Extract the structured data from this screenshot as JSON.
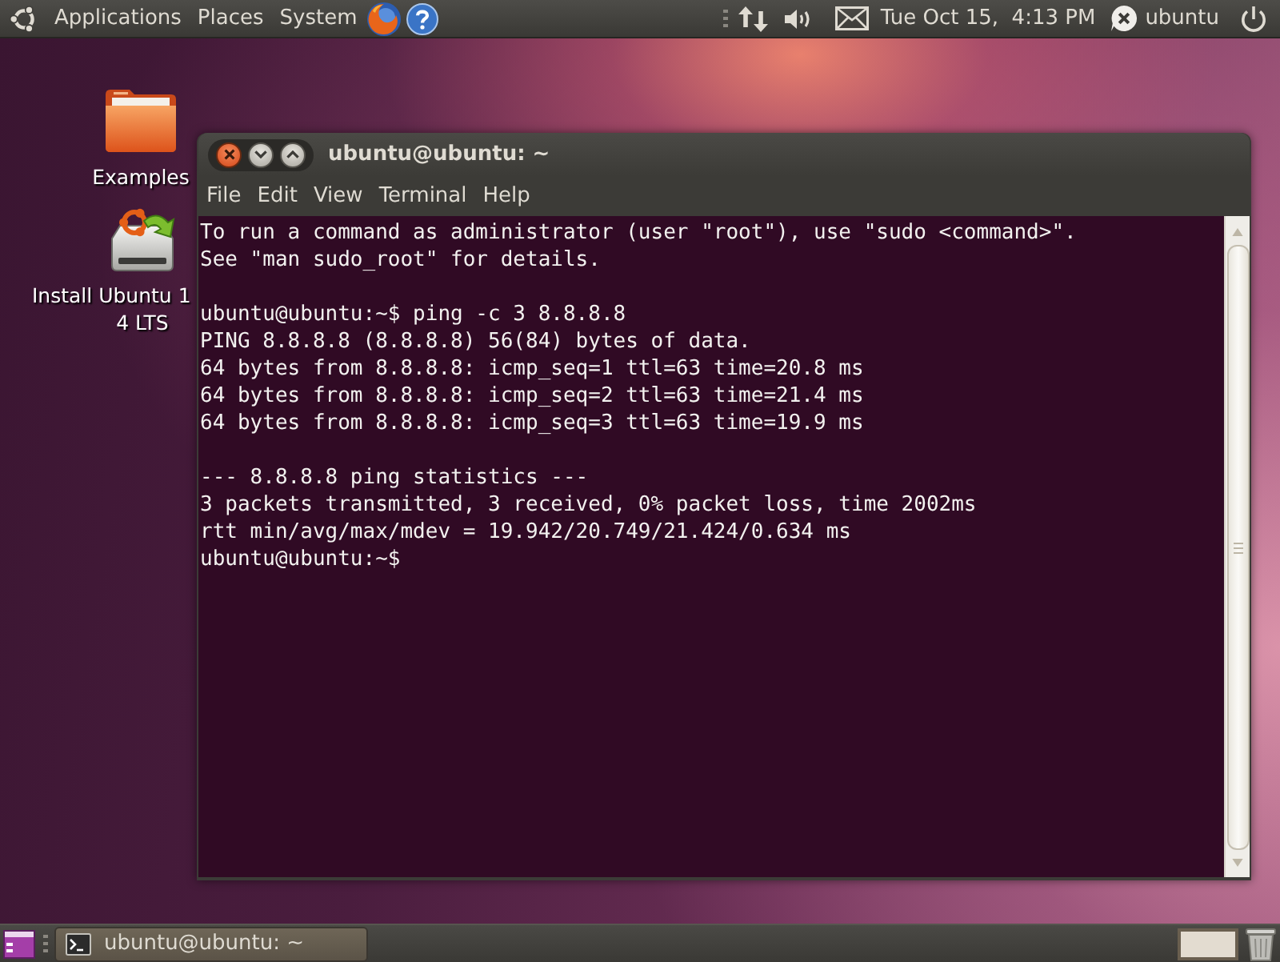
{
  "top_panel": {
    "menus": [
      "Applications",
      "Places",
      "System"
    ],
    "clock": "Tue Oct 15,  4:13 PM",
    "user": "ubuntu"
  },
  "desktop_icons": [
    {
      "kind": "folder",
      "label": [
        "Examples"
      ]
    },
    {
      "kind": "installer",
      "label": [
        "Install Ubuntu 1",
        "4 LTS"
      ]
    }
  ],
  "terminal": {
    "title": "ubuntu@ubuntu: ~",
    "menu": [
      "File",
      "Edit",
      "View",
      "Terminal",
      "Help"
    ],
    "blocks": [
      [
        "To run a command as administrator (user \"root\"), use \"sudo <command>\".",
        "See \"man sudo_root\" for details."
      ],
      [
        "ubuntu@ubuntu:~$ ping -c 3 8.8.8.8",
        "PING 8.8.8.8 (8.8.8.8) 56(84) bytes of data.",
        "64 bytes from 8.8.8.8: icmp_seq=1 ttl=63 time=20.8 ms",
        "64 bytes from 8.8.8.8: icmp_seq=2 ttl=63 time=21.4 ms",
        "64 bytes from 8.8.8.8: icmp_seq=3 ttl=63 time=19.9 ms"
      ],
      [
        "--- 8.8.8.8 ping statistics ---",
        "3 packets transmitted, 3 received, 0% packet loss, time 2002ms",
        "rtt min/avg/max/mdev = 19.942/20.749/21.424/0.634 ms",
        "ubuntu@ubuntu:~$"
      ]
    ]
  },
  "bottom_panel": {
    "tasks": [
      {
        "title": "ubuntu@ubuntu: ~",
        "selected": true
      }
    ]
  }
}
